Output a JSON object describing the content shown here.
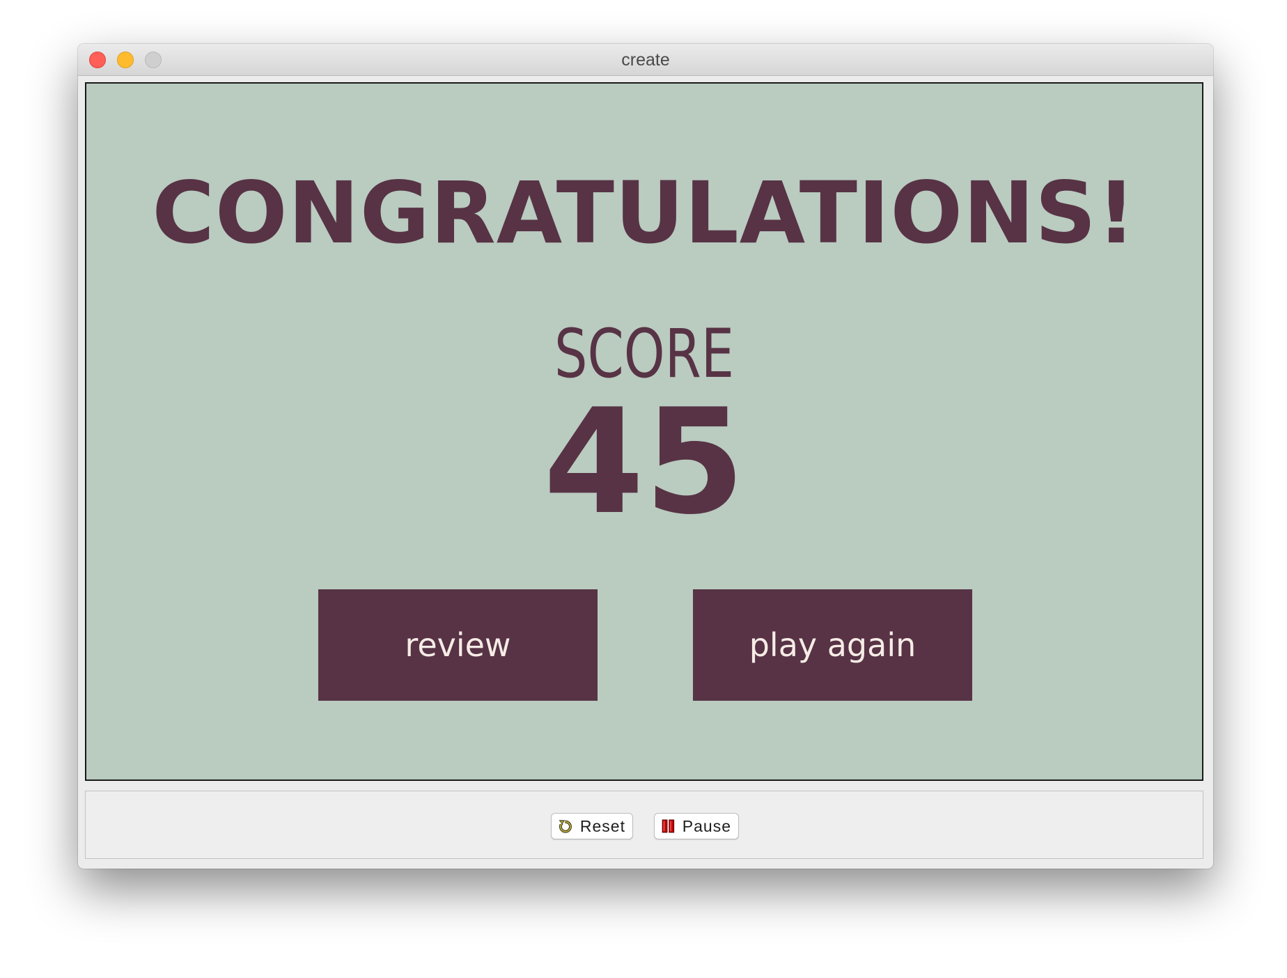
{
  "window": {
    "title": "create"
  },
  "game": {
    "headline": "CONGRATULATIONS!",
    "score_label": "SCORE",
    "score_value": "45",
    "review_label": "review",
    "play_again_label": "play again"
  },
  "controls": {
    "reset_label": "Reset",
    "pause_label": "Pause",
    "reset_icon": "reset-icon",
    "pause_icon": "pause-icon"
  },
  "colors": {
    "game_background": "#bacbc0",
    "accent": "#573345",
    "button_text": "#f6ece6"
  }
}
